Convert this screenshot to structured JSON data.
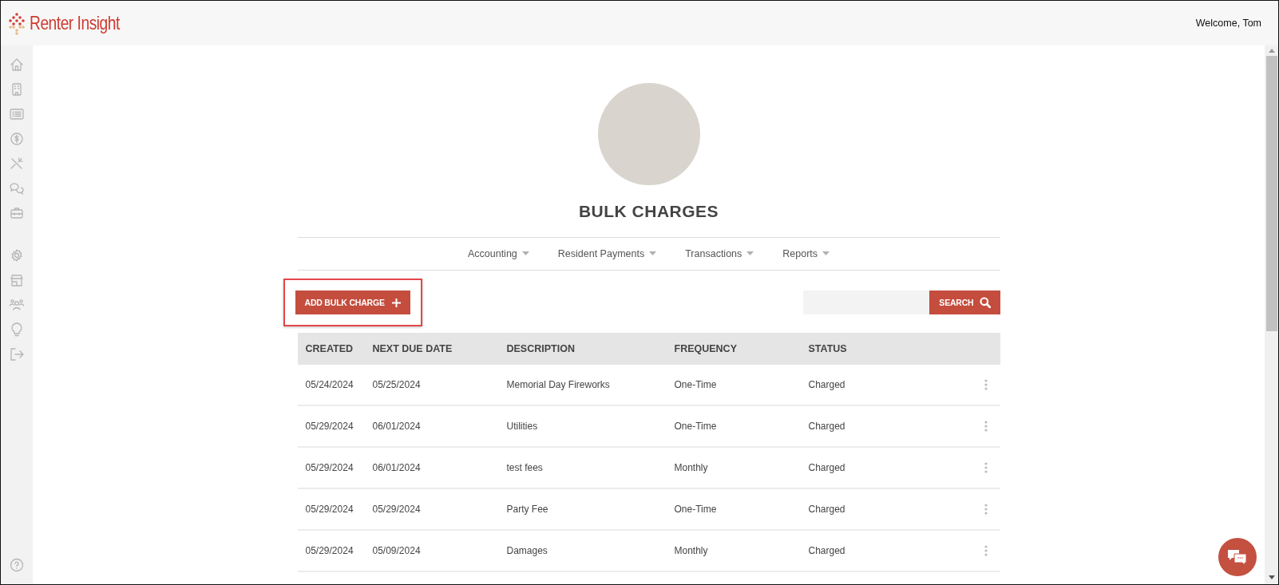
{
  "header": {
    "logo": "Renter Insight",
    "welcome": "Welcome, Tom"
  },
  "page": {
    "title": "BULK CHARGES"
  },
  "subnav": [
    {
      "label": "Accounting"
    },
    {
      "label": "Resident Payments"
    },
    {
      "label": "Transactions"
    },
    {
      "label": "Reports"
    }
  ],
  "toolbar": {
    "add_button": "ADD BULK CHARGE",
    "highlighted": true,
    "search": {
      "button": "SEARCH"
    }
  },
  "table": {
    "columns": [
      "CREATED",
      "NEXT DUE DATE",
      "DESCRIPTION",
      "FREQUENCY",
      "STATUS"
    ],
    "rows": [
      {
        "cells": [
          "05/24/2024",
          "05/25/2024",
          "Memorial Day Fireworks",
          "One-Time",
          "Charged"
        ]
      },
      {
        "cells": [
          "05/29/2024",
          "06/01/2024",
          "Utilities",
          "One-Time",
          "Charged"
        ]
      },
      {
        "cells": [
          "05/29/2024",
          "06/01/2024",
          "test fees",
          "Monthly",
          "Charged"
        ]
      },
      {
        "cells": [
          "05/29/2024",
          "05/29/2024",
          "Party Fee",
          "One-Time",
          "Charged"
        ]
      },
      {
        "cells": [
          "05/29/2024",
          "05/09/2024",
          "Damages",
          "Monthly",
          "Charged"
        ]
      }
    ]
  }
}
